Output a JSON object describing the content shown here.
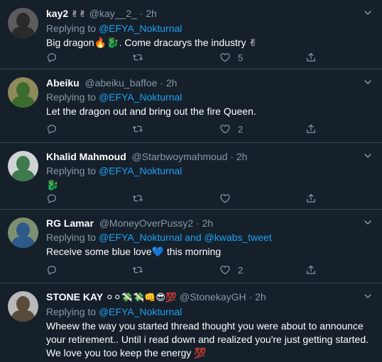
{
  "tweets": [
    {
      "name": "kay2",
      "name_emoji": "✌✌",
      "handle": "@kay__2_",
      "time": "2h",
      "reply_prefix": "Replying to",
      "mentions": "@EFYA_Nokturnal",
      "text": "Big dragon🔥🐉. Come dracarys the industry ✌",
      "reply_count": "",
      "retweet_count": "",
      "like_count": "5",
      "avatar_bg": "#5c5c5c",
      "avatar_fg": "#2a2a2a"
    },
    {
      "name": "Abeiku",
      "name_emoji": "",
      "handle": "@abeiku_baffoe",
      "time": "2h",
      "reply_prefix": "Replying to",
      "mentions": "@EFYA_Nokturnal",
      "text": "Let the dragon out and bring out the fire Queen.",
      "reply_count": "",
      "retweet_count": "",
      "like_count": "2",
      "avatar_bg": "#8f8a5a",
      "avatar_fg": "#3b6b2d"
    },
    {
      "name": "Khalid Mahmoud",
      "name_emoji": "",
      "handle": "@Starbwoymahmoud",
      "time": "2h",
      "reply_prefix": "Replying to",
      "mentions": "@EFYA_Nokturnal",
      "text": "🐉",
      "reply_count": "",
      "retweet_count": "",
      "like_count": "",
      "avatar_bg": "#cfd3d4",
      "avatar_fg": "#3e7a4c"
    },
    {
      "name": "RG Lamar",
      "name_emoji": "",
      "handle": "@MoneyOverPussy2",
      "time": "2h",
      "reply_prefix": "Replying to",
      "mentions": "@EFYA_Nokturnal and @kwabs_tweet",
      "text": "Receive some blue love💙 this morning",
      "reply_count": "",
      "retweet_count": "",
      "like_count": "2",
      "avatar_bg": "#7d8f70",
      "avatar_fg": "#2e5a8a"
    },
    {
      "name": "STONE KAY",
      "name_emoji": "⚪⚪💸💸👊😎💯",
      "handle": "@StonekayGH",
      "time": "2h",
      "reply_prefix": "Replying to",
      "mentions": "@EFYA_Nokturnal",
      "text": "Wheew the way you started thread thought you were about to announce your retirement.. Until i read down and realized you're just getting started. We love you too keep the energy 💯",
      "reply_count": "",
      "retweet_count": "",
      "like_count": "",
      "avatar_bg": "#b9b9b9",
      "avatar_fg": "#5a4a3a"
    }
  ],
  "separator": "·",
  "icons": {
    "reply": "reply-icon",
    "retweet": "retweet-icon",
    "like": "heart-icon",
    "share": "share-icon",
    "more": "chevron-down-icon"
  },
  "colors": {
    "background": "#15202b",
    "border": "#38444d",
    "muted": "#8899a6",
    "accent": "#1da1f2"
  }
}
